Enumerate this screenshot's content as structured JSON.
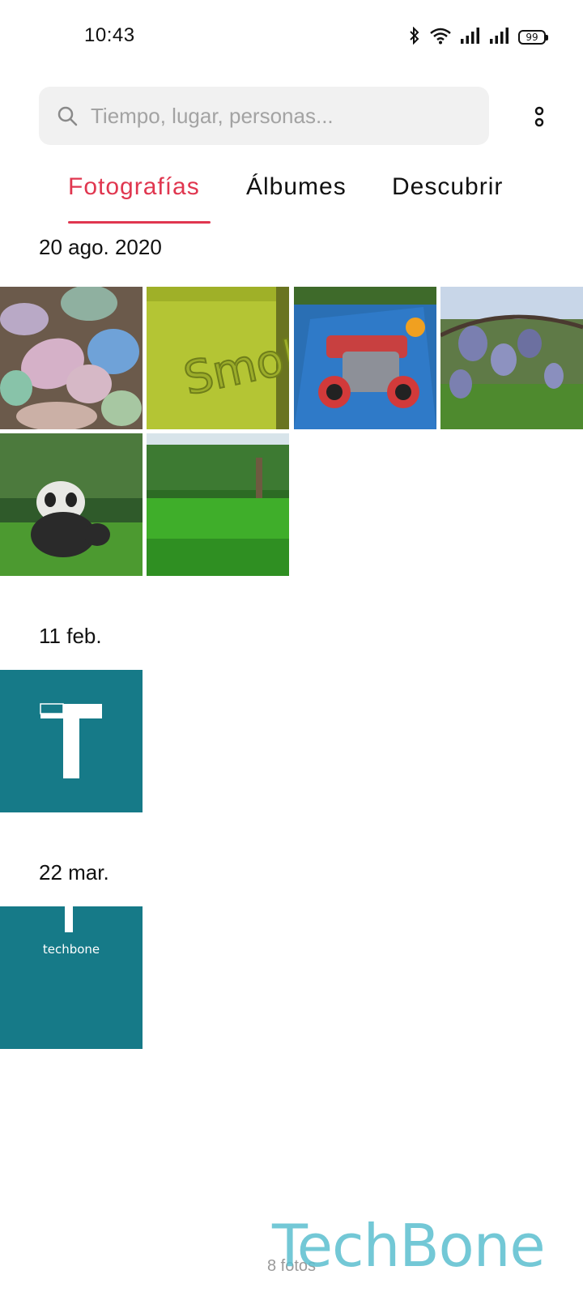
{
  "status_bar": {
    "time": "10:43",
    "battery": "99",
    "icons": [
      "bluetooth-icon",
      "wifi-icon",
      "signal-icon",
      "signal-icon",
      "battery-icon"
    ]
  },
  "search": {
    "placeholder": "Tiempo, lugar, personas..."
  },
  "tabs": [
    {
      "label": "Fotografías",
      "active": true
    },
    {
      "label": "Álbumes",
      "active": false
    },
    {
      "label": "Descubrir",
      "active": false
    }
  ],
  "sections": [
    {
      "date": "20 ago. 2020",
      "photo_count": 6
    },
    {
      "date": "11 feb.",
      "photo_count": 1
    },
    {
      "date": "22 mar.",
      "photo_count": 1
    }
  ],
  "thumbnail_texts": {
    "toy_brand": "Smoby",
    "logo_letter": "T",
    "logo_word": "techbone"
  },
  "footer": {
    "count": "8 fotos"
  },
  "watermark": "TechBone",
  "colors": {
    "accent": "#e0364f",
    "teal_tile": "#167a88",
    "watermark": "#5bbfcf"
  }
}
